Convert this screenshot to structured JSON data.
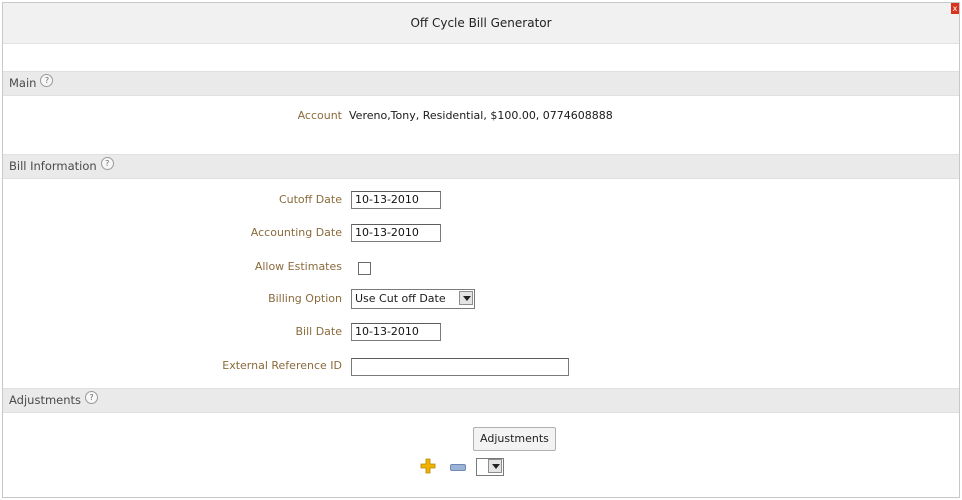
{
  "window": {
    "title": "Off Cycle Bill Generator",
    "close_label": "x"
  },
  "sections": {
    "main": {
      "title": "Main",
      "help_glyph": "?",
      "account_label": "Account",
      "account_value": "Vereno,Tony, Residential, $100.00, 0774608888"
    },
    "bill_information": {
      "title": "Bill Information",
      "help_glyph": "?",
      "fields": {
        "cutoff_date": {
          "label": "Cutoff Date",
          "value": "10-13-2010"
        },
        "accounting_date": {
          "label": "Accounting Date",
          "value": "10-13-2010"
        },
        "allow_estimates": {
          "label": "Allow Estimates",
          "checked": false
        },
        "billing_option": {
          "label": "Billing Option",
          "selected": "Use Cut off Date"
        },
        "bill_date": {
          "label": "Bill Date",
          "value": "10-13-2010"
        },
        "external_reference_id": {
          "label": "External Reference ID",
          "value": ""
        }
      }
    },
    "adjustments": {
      "title": "Adjustments",
      "help_glyph": "?",
      "button_label": "Adjustments",
      "select_selected": ""
    }
  },
  "icons": {
    "help": "help-icon",
    "add": "plus-icon",
    "remove": "minus-icon",
    "dropdown": "chevron-down-icon",
    "close": "close-icon"
  },
  "colors": {
    "label_text": "#8a6b3c",
    "section_bg": "#eaeaea",
    "plus_icon": "#f0b400",
    "close_button": "#d9321f"
  }
}
